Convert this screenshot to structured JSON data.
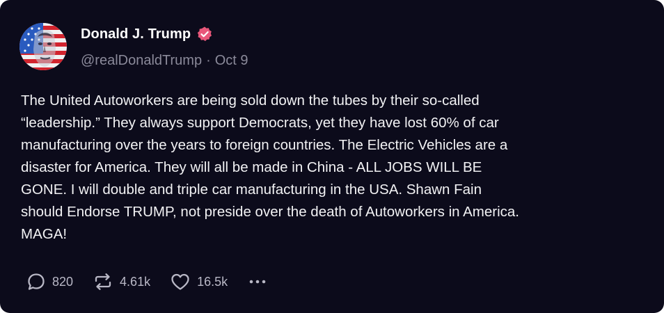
{
  "post": {
    "author": {
      "display_name": "Donald J. Trump",
      "handle": "@realDonaldTrump",
      "verified_icon": "verified-badge-icon",
      "verified_color": "#e8577a",
      "avatar_icon": "avatar-flag-portrait"
    },
    "separator": "·",
    "date": "Oct 9",
    "text": "The United Autoworkers are being sold down the tubes by their so-called\n“leadership.” They always support Democrats, yet they have lost 60% of car\nmanufacturing over the years to foreign countries. The Electric Vehicles are a\ndisaster for America. They will all be made in China - ALL JOBS WILL BE\nGONE. I will double and triple car manufacturing in the USA. Shawn Fain\nshould Endorse TRUMP, not preside over the death of Autoworkers in America.\nMAGA!",
    "actions": {
      "replies": {
        "icon": "reply-bubble-icon",
        "count": "820"
      },
      "reposts": {
        "icon": "repost-icon",
        "count": "4.61k"
      },
      "likes": {
        "icon": "heart-icon",
        "count": "16.5k"
      },
      "more": {
        "icon": "more-dots-icon"
      }
    }
  },
  "colors": {
    "background": "#0c0b1b",
    "primary_text": "#ffffff",
    "secondary_text": "#8b8a9a",
    "action_text": "#b9b8c6"
  }
}
